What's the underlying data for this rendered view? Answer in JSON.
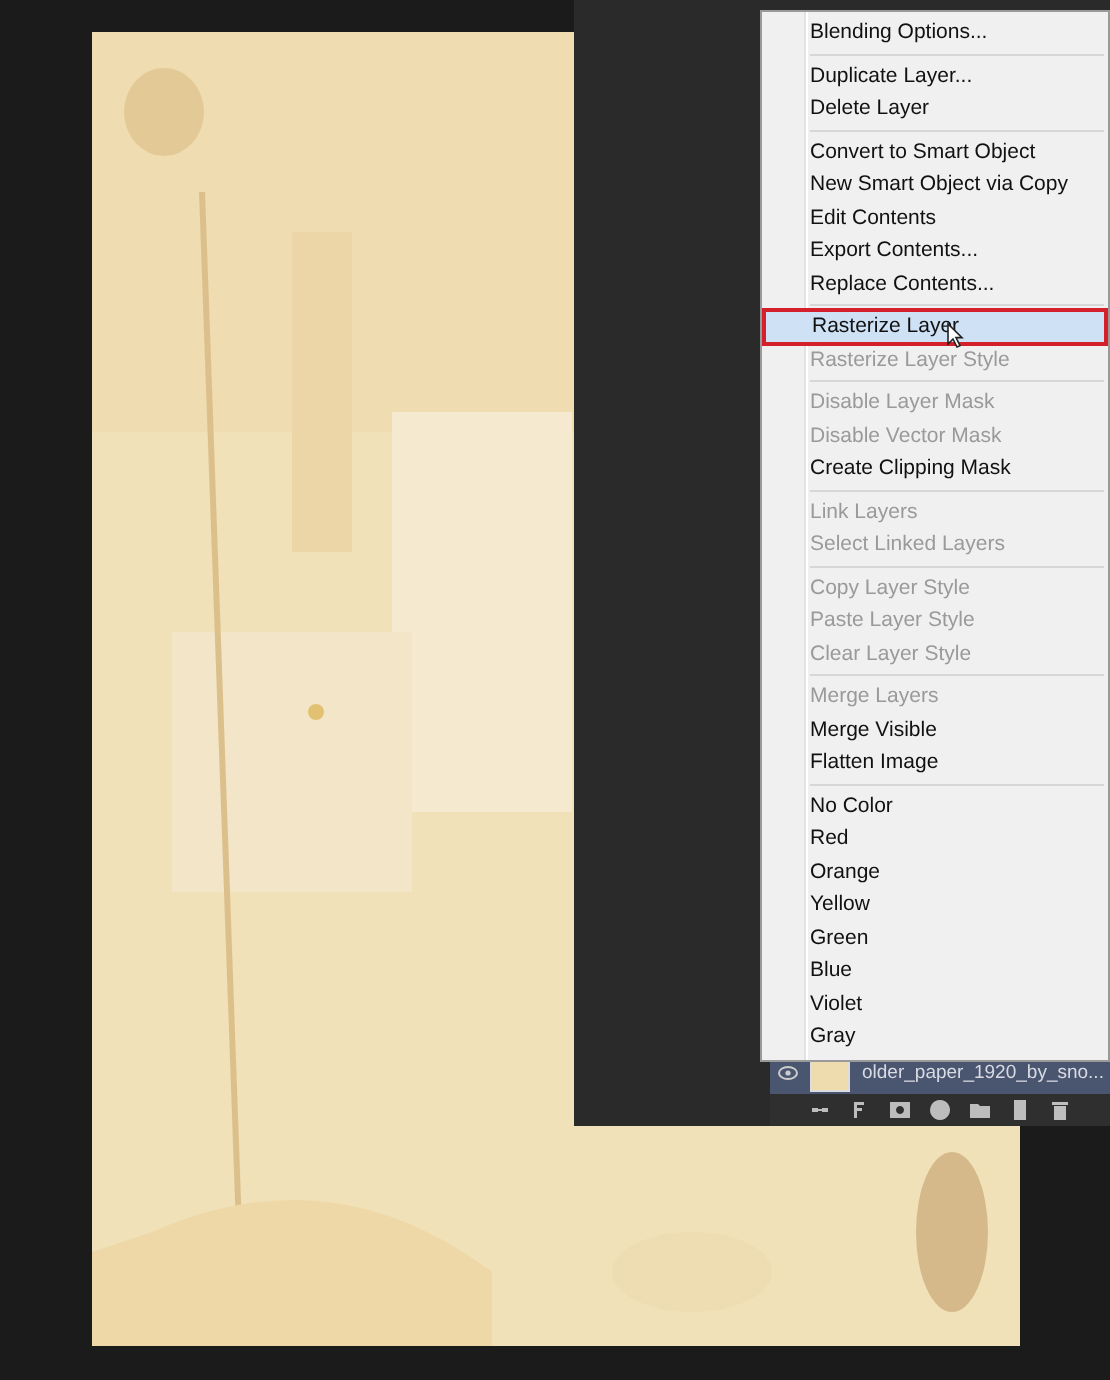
{
  "menu": {
    "groups": [
      [
        {
          "label": "Blending Options...",
          "disabled": false,
          "selected": false
        }
      ],
      [
        {
          "label": "Duplicate Layer...",
          "disabled": false,
          "selected": false
        },
        {
          "label": "Delete Layer",
          "disabled": false,
          "selected": false
        }
      ],
      [
        {
          "label": "Convert to Smart Object",
          "disabled": false,
          "selected": false
        },
        {
          "label": "New Smart Object via Copy",
          "disabled": false,
          "selected": false
        },
        {
          "label": "Edit Contents",
          "disabled": false,
          "selected": false
        },
        {
          "label": "Export Contents...",
          "disabled": false,
          "selected": false
        },
        {
          "label": "Replace Contents...",
          "disabled": false,
          "selected": false
        }
      ],
      [
        {
          "label": "Rasterize Layer",
          "disabled": false,
          "selected": true
        },
        {
          "label": "Rasterize Layer Style",
          "disabled": true,
          "selected": false
        }
      ],
      [
        {
          "label": "Disable Layer Mask",
          "disabled": true,
          "selected": false
        },
        {
          "label": "Disable Vector Mask",
          "disabled": true,
          "selected": false
        },
        {
          "label": "Create Clipping Mask",
          "disabled": false,
          "selected": false
        }
      ],
      [
        {
          "label": "Link Layers",
          "disabled": true,
          "selected": false
        },
        {
          "label": "Select Linked Layers",
          "disabled": true,
          "selected": false
        }
      ],
      [
        {
          "label": "Copy Layer Style",
          "disabled": true,
          "selected": false
        },
        {
          "label": "Paste Layer Style",
          "disabled": true,
          "selected": false
        },
        {
          "label": "Clear Layer Style",
          "disabled": true,
          "selected": false
        }
      ],
      [
        {
          "label": "Merge Layers",
          "disabled": true,
          "selected": false
        },
        {
          "label": "Merge Visible",
          "disabled": false,
          "selected": false
        },
        {
          "label": "Flatten Image",
          "disabled": false,
          "selected": false
        }
      ],
      [
        {
          "label": "No Color",
          "disabled": false,
          "selected": false
        },
        {
          "label": "Red",
          "disabled": false,
          "selected": false
        },
        {
          "label": "Orange",
          "disabled": false,
          "selected": false
        },
        {
          "label": "Yellow",
          "disabled": false,
          "selected": false
        },
        {
          "label": "Green",
          "disabled": false,
          "selected": false
        },
        {
          "label": "Blue",
          "disabled": false,
          "selected": false
        },
        {
          "label": "Violet",
          "disabled": false,
          "selected": false
        },
        {
          "label": "Gray",
          "disabled": false,
          "selected": false
        }
      ]
    ]
  },
  "layer": {
    "name": "older_paper_1920_by_sno...",
    "selected": true
  }
}
